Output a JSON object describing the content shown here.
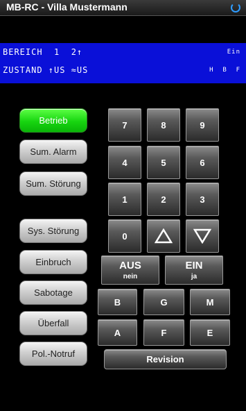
{
  "app": {
    "title": "MB-RC - Villa Mustermann"
  },
  "display": {
    "line1_left": "BEREICH  1  2↑",
    "line1_right": "Ein",
    "line2_left": "ZUSTAND ↑US ≈US",
    "line2_right": "H  B  F"
  },
  "status_buttons": [
    {
      "label": "Betrieb"
    },
    {
      "label": "Sum. Alarm"
    },
    {
      "label": "Sum. Störung"
    },
    {
      "label": "Sys. Störung"
    },
    {
      "label": "Einbruch"
    },
    {
      "label": "Sabotage"
    },
    {
      "label": "Überfall"
    },
    {
      "label": "Pol.-Notruf"
    }
  ],
  "keypad": {
    "digits": [
      "7",
      "8",
      "9",
      "4",
      "5",
      "6",
      "1",
      "2",
      "3",
      "0"
    ],
    "aus": {
      "label": "AUS",
      "sub": "nein"
    },
    "ein": {
      "label": "EIN",
      "sub": "ja"
    },
    "letters": [
      "B",
      "G",
      "M",
      "A",
      "F",
      "E"
    ],
    "revision": "Revision"
  }
}
